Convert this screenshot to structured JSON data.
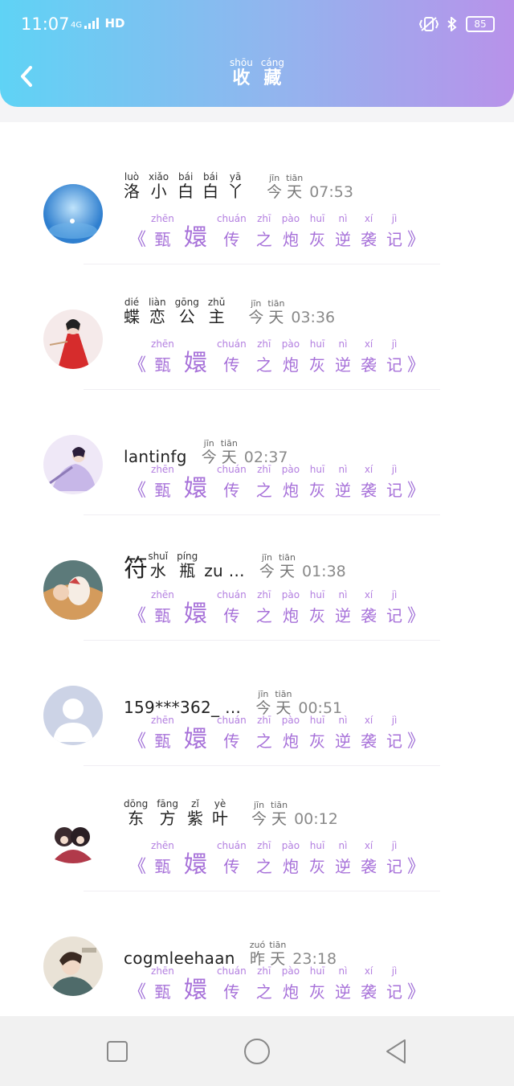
{
  "status": {
    "time": "11:07",
    "network": "4G",
    "hd": "HD",
    "battery": "85"
  },
  "header": {
    "title_chars": [
      {
        "c": "收",
        "p": "shōu"
      },
      {
        "c": "藏",
        "p": "cáng"
      }
    ]
  },
  "book_title": {
    "open": "《",
    "close": "》",
    "chars": [
      {
        "c": "甄",
        "p": "zhēn"
      },
      {
        "c": "嬛",
        "p": ""
      },
      {
        "c": "传",
        "p": "chuán"
      },
      {
        "c": "之",
        "p": "zhī"
      },
      {
        "c": "炮",
        "p": "pào"
      },
      {
        "c": "灰",
        "p": "huī"
      },
      {
        "c": "逆",
        "p": "nì"
      },
      {
        "c": "袭",
        "p": "xí"
      },
      {
        "c": "记",
        "p": "jì"
      }
    ]
  },
  "items": [
    {
      "name_chars": [
        {
          "c": "洛",
          "p": "luò"
        },
        {
          "c": "小",
          "p": "xiǎo"
        },
        {
          "c": "白",
          "p": "bái"
        },
        {
          "c": "白",
          "p": "bái"
        },
        {
          "c": "丫",
          "p": "yā"
        }
      ],
      "day": [
        {
          "c": "今",
          "p": "jīn"
        },
        {
          "c": "天",
          "p": "tiān"
        }
      ],
      "time": "07:53"
    },
    {
      "name_chars": [
        {
          "c": "蝶",
          "p": "dié"
        },
        {
          "c": "恋",
          "p": "liàn"
        },
        {
          "c": "公",
          "p": "gōng"
        },
        {
          "c": "主",
          "p": "zhǔ"
        }
      ],
      "day": [
        {
          "c": "今",
          "p": "jīn"
        },
        {
          "c": "天",
          "p": "tiān"
        }
      ],
      "time": "03:36"
    },
    {
      "name_plain": "lantinfg",
      "day": [
        {
          "c": "今",
          "p": "jīn"
        },
        {
          "c": "天",
          "p": "tiān"
        }
      ],
      "time": "02:37"
    },
    {
      "name_prefix": "符",
      "name_chars": [
        {
          "c": "水",
          "p": "shuǐ"
        },
        {
          "c": "瓶",
          "p": "píng"
        }
      ],
      "name_suffix": "zu …",
      "day": [
        {
          "c": "今",
          "p": "jīn"
        },
        {
          "c": "天",
          "p": "tiān"
        }
      ],
      "time": "01:38"
    },
    {
      "name_plain": "159***362_ …",
      "day": [
        {
          "c": "今",
          "p": "jīn"
        },
        {
          "c": "天",
          "p": "tiān"
        }
      ],
      "time": "00:51"
    },
    {
      "name_chars": [
        {
          "c": "东",
          "p": "dōng"
        },
        {
          "c": "方",
          "p": "fāng"
        },
        {
          "c": "紫",
          "p": "zǐ"
        },
        {
          "c": "叶",
          "p": "yè"
        }
      ],
      "day": [
        {
          "c": "今",
          "p": "jīn"
        },
        {
          "c": "天",
          "p": "tiān"
        }
      ],
      "time": "00:12"
    },
    {
      "name_plain": "cogmleehaan",
      "day": [
        {
          "c": "昨",
          "p": "zuó"
        },
        {
          "c": "天",
          "p": "tiān"
        }
      ],
      "time": "23:18"
    }
  ],
  "nav": [
    "recent-apps",
    "home",
    "back"
  ]
}
